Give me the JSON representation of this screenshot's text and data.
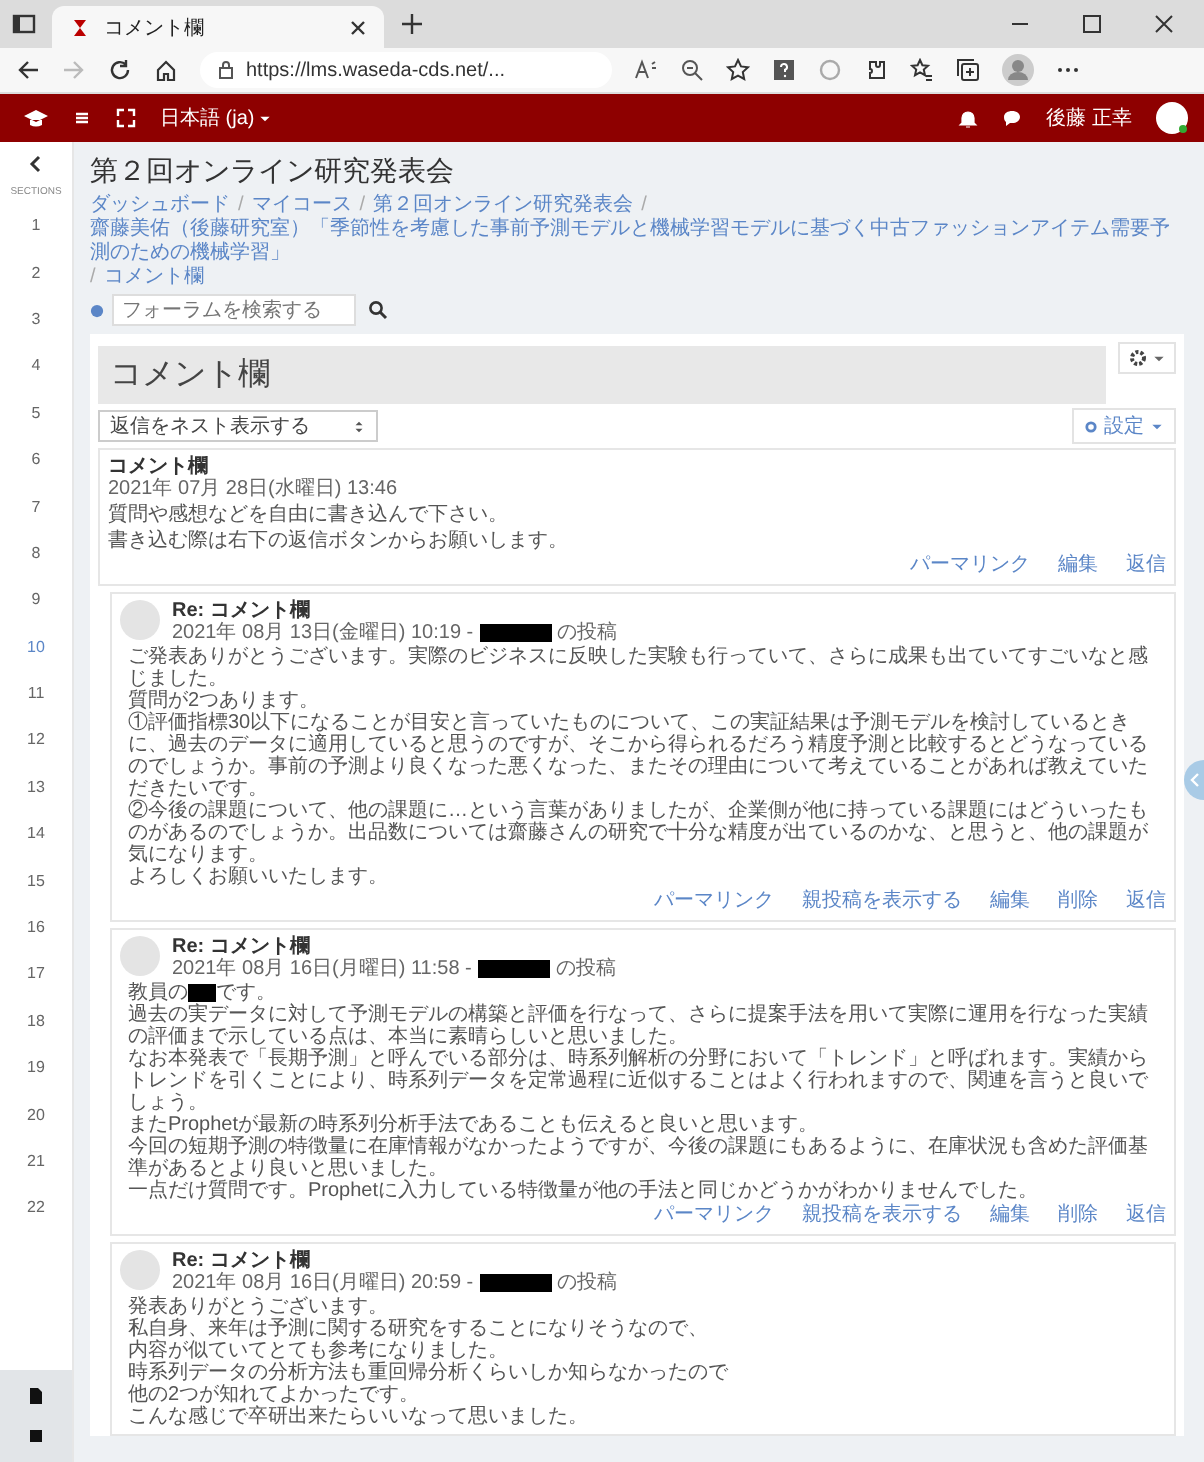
{
  "browser": {
    "tab_title": "コメント欄",
    "url": "https://lms.waseda-cds.net/..."
  },
  "header": {
    "language": "日本語 (ja)",
    "user": "後藤 正幸"
  },
  "sidebar": {
    "label": "SECTIONS",
    "items": [
      {
        "label": "1",
        "selected": false
      },
      {
        "label": "2",
        "selected": false
      },
      {
        "label": "3",
        "selected": false
      },
      {
        "label": "4",
        "selected": false
      },
      {
        "label": "5",
        "selected": false
      },
      {
        "label": "6",
        "selected": false
      },
      {
        "label": "7",
        "selected": false
      },
      {
        "label": "8",
        "selected": false
      },
      {
        "label": "9",
        "selected": false
      },
      {
        "label": "10",
        "selected": true
      },
      {
        "label": "11",
        "selected": false
      },
      {
        "label": "12",
        "selected": false
      },
      {
        "label": "13",
        "selected": false
      },
      {
        "label": "14",
        "selected": false
      },
      {
        "label": "15",
        "selected": false
      },
      {
        "label": "16",
        "selected": false
      },
      {
        "label": "17",
        "selected": false
      },
      {
        "label": "18",
        "selected": false
      },
      {
        "label": "19",
        "selected": false
      },
      {
        "label": "20",
        "selected": false
      },
      {
        "label": "21",
        "selected": false
      },
      {
        "label": "22",
        "selected": false
      }
    ]
  },
  "page_title": "第２回オンライン研究発表会",
  "breadcrumb": [
    "ダッシュボード",
    "マイコース",
    "第２回オンライン研究発表会",
    "齋藤美佑（後藤研究室）「季節性を考慮した事前予測モデルと機械学習モデルに基づく中古ファッションアイテム需要予測のための機械学習」",
    "コメント欄"
  ],
  "breadcrumb_separator": "/",
  "search": {
    "placeholder": "フォーラムを検索する"
  },
  "forum": {
    "heading": "コメント欄",
    "settings_button": "設定",
    "display_mode": "返信をネスト表示する",
    "discussion": {
      "subject": "コメント欄",
      "date": "2021年 07月 28日(水曜日) 13:46",
      "body": [
        "質問や感想などを自由に書き込んで下さい。",
        "書き込む際は右下の返信ボタンからお願いします。"
      ],
      "actions": [
        "パーマリンク",
        "編集",
        "返信"
      ]
    },
    "replies": [
      {
        "subject": "Re: コメント欄",
        "date": "2021年 08月 13日(金曜日) 10:19 -",
        "posted": "の投稿",
        "body": [
          "ご発表ありがとうございます。実際のビジネスに反映した実験も行っていて、さらに成果も出ていてすごいなと感じました。",
          "質問が2つあります。",
          "①評価指標30以下になることが目安と言っていたものについて、この実証結果は予測モデルを検討しているときに、過去のデータに適用していると思うのですが、そこから得られるだろう精度予測と比較するとどうなっているのでしょうか。事前の予測より良くなった悪くなった、またその理由について考えていることがあれば教えていただきたいです。",
          "②今後の課題について、他の課題に…という言葉がありましたが、企業側が他に持っている課題にはどういったものがあるのでしょうか。出品数については齋藤さんの研究で十分な精度が出ているのかな、と思うと、他の課題が気になります。",
          "よろしくお願いいたします。"
        ],
        "actions": [
          "パーマリンク",
          "親投稿を表示する",
          "編集",
          "削除",
          "返信"
        ]
      },
      {
        "subject": "Re: コメント欄",
        "date": "2021年 08月 16日(月曜日) 11:58 -",
        "posted": "の投稿",
        "intro": {
          "before": "教員の",
          "after": "です。"
        },
        "body": [
          "過去の実データに対して予測モデルの構築と評価を行なって、さらに提案手法を用いて実際に運用を行なった実績の評価まで示している点は、本当に素晴らしいと思いました。",
          "なお本発表で「長期予測」と呼んでいる部分は、時系列解析の分野において「トレンド」と呼ばれます。実績からトレンドを引くことにより、時系列データを定常過程に近似することはよく行われますので、関連を言うと良いでしょう。",
          "またProphetが最新の時系列分析手法であることも伝えると良いと思います。",
          "今回の短期予測の特徴量に在庫情報がなかったようですが、今後の課題にもあるように、在庫状況も含めた評価基準があるとより良いと思いました。",
          "一点だけ質問です。Prophetに入力している特徴量が他の手法と同じかどうかがわかりませんでした。"
        ],
        "actions": [
          "パーマリンク",
          "親投稿を表示する",
          "編集",
          "削除",
          "返信"
        ]
      },
      {
        "subject": "Re: コメント欄",
        "date": "2021年 08月 16日(月曜日) 20:59 -",
        "posted": "の投稿",
        "body": [
          "発表ありがとうございます。",
          "私自身、来年は予測に関する研究をすることになりそうなので、",
          "内容が似ていてとても参考になりました。",
          "時系列データの分析方法も重回帰分析くらいしか知らなかったので",
          "他の2つが知れてよかったです。",
          "こんな感じで卒研出来たらいいなって思いました。"
        ]
      }
    ]
  }
}
